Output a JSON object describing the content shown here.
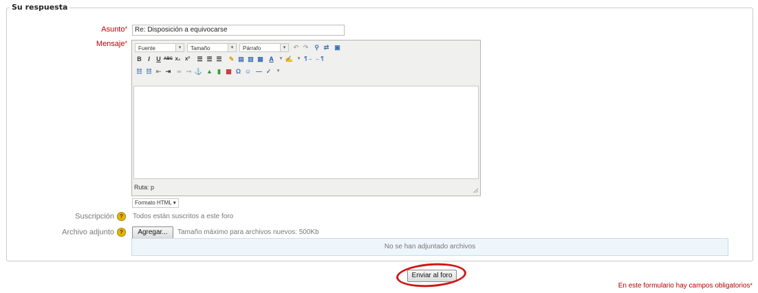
{
  "fieldset": {
    "legend": "Su respuesta"
  },
  "subject": {
    "label": "Asunto",
    "value": "Re: Disposición a equivocarse"
  },
  "message": {
    "label": "Mensaje",
    "toolbar": {
      "font_select": "Fuente",
      "size_select": "Tamaño",
      "paragraph_select": "Párrafo",
      "row2": [
        "B",
        "I",
        "U",
        "ABC",
        "x₂",
        "x²"
      ],
      "row3_icons": [
        "bullet-list-icon",
        "numbered-list-icon",
        "outdent-icon",
        "indent-icon",
        "link-icon",
        "unlink-icon",
        "anchor-icon",
        "image-icon",
        "media-icon",
        "table-icon",
        "char-map-icon",
        "emoticon-icon",
        "hr-icon",
        "spellcheck-icon"
      ]
    },
    "path_label": "Ruta: p",
    "format_select": "Formato HTML"
  },
  "subscription": {
    "label": "Suscripción",
    "text": "Todos están suscritos a este foro"
  },
  "attachment": {
    "label": "Archivo adjunto",
    "add_button": "Agregar...",
    "max_size_text": "Tamaño máximo para archivos nuevos: 500Kb",
    "empty_text": "No se han adjuntado archivos"
  },
  "submit_label": "Enviar al foro",
  "required_note": "En este formulario hay campos obligatorios",
  "required_marker": "*",
  "colors": {
    "required": "#b30000",
    "highlight": "#d01515",
    "file_box": "#eef5fb"
  }
}
